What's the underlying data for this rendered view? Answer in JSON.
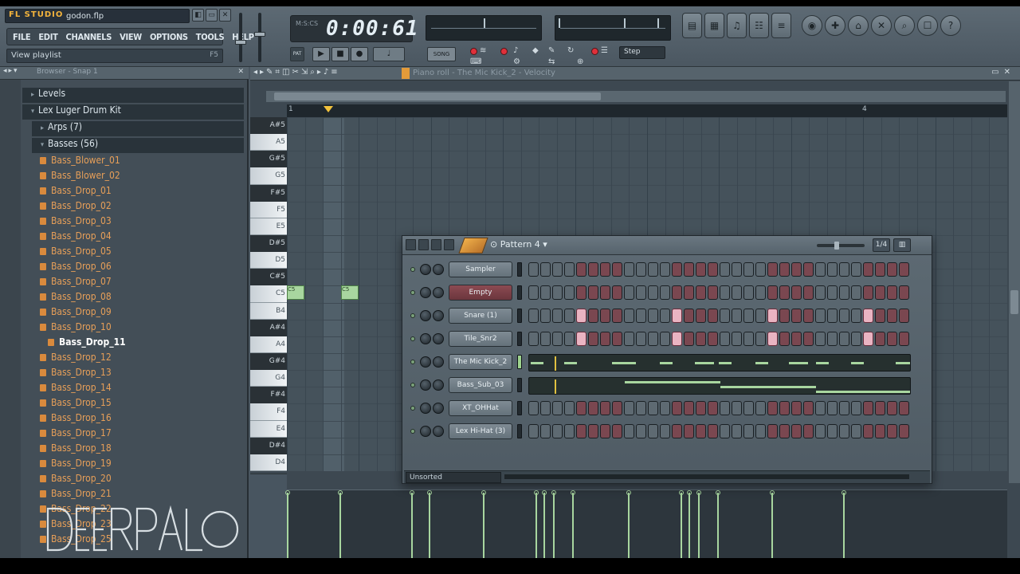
{
  "app": {
    "logo": "FL STUDIO",
    "file_name": "godon.flp",
    "window_buttons": [
      "◧",
      "▭",
      "✕"
    ]
  },
  "menu": [
    "FILE",
    "EDIT",
    "CHANNELS",
    "VIEW",
    "OPTIONS",
    "TOOLS",
    "HELP"
  ],
  "hint": {
    "text": "View playlist",
    "shortcut": "F5"
  },
  "time_display": {
    "value": "0:00:61",
    "mode": "M:S:CS"
  },
  "transport": {
    "pattern_mode": "PAT",
    "song_mode": "SONG",
    "step_label": "Step"
  },
  "browser": {
    "title": "Browser - Snap 1",
    "folders": [
      {
        "label": "Levels",
        "level": 1
      },
      {
        "label": "Lex Luger Drum Kit",
        "level": 1
      },
      {
        "label": "Arps (7)",
        "level": 2
      },
      {
        "label": "Basses (56)",
        "level": 2
      }
    ],
    "files": [
      "Bass_Blower_01",
      "Bass_Blower_02",
      "Bass_Drop_01",
      "Bass_Drop_02",
      "Bass_Drop_03",
      "Bass_Drop_04",
      "Bass_Drop_05",
      "Bass_Drop_06",
      "Bass_Drop_07",
      "Bass_Drop_08",
      "Bass_Drop_09",
      "Bass_Drop_10",
      "Bass_Drop_11",
      "Bass_Drop_12",
      "Bass_Drop_13",
      "Bass_Drop_14",
      "Bass_Drop_15",
      "Bass_Drop_16",
      "Bass_Drop_17",
      "Bass_Drop_18",
      "Bass_Drop_19",
      "Bass_Drop_20",
      "Bass_Drop_21",
      "Bass_Drop_22",
      "Bass_Drop_23",
      "Bass_Drop_25"
    ],
    "selected_file": "Bass_Drop_11",
    "watermark": "DEFERPALO"
  },
  "piano_roll": {
    "title": "Piano roll - The Mic Kick_2 - Velocity",
    "bar_numbers": [
      "1",
      "4"
    ],
    "keys": [
      {
        "label": "A#5",
        "type": "black"
      },
      {
        "label": "A5",
        "type": "white"
      },
      {
        "label": "G#5",
        "type": "black"
      },
      {
        "label": "G5",
        "type": "white"
      },
      {
        "label": "F#5",
        "type": "black"
      },
      {
        "label": "F5",
        "type": "white"
      },
      {
        "label": "E5",
        "type": "white"
      },
      {
        "label": "D#5",
        "type": "black"
      },
      {
        "label": "D5",
        "type": "white"
      },
      {
        "label": "C#5",
        "type": "black"
      },
      {
        "label": "C5",
        "type": "white"
      },
      {
        "label": "B4",
        "type": "white"
      },
      {
        "label": "A#4",
        "type": "black"
      },
      {
        "label": "A4",
        "type": "white"
      },
      {
        "label": "G#4",
        "type": "black"
      },
      {
        "label": "G4",
        "type": "white"
      },
      {
        "label": "F#4",
        "type": "black"
      },
      {
        "label": "F4",
        "type": "white"
      },
      {
        "label": "E4",
        "type": "white"
      },
      {
        "label": "D#4",
        "type": "black"
      },
      {
        "label": "D4",
        "type": "white"
      }
    ],
    "notes": [
      {
        "label": "C5",
        "step": 0
      },
      {
        "label": "C5",
        "step": 4
      }
    ]
  },
  "step_sequencer": {
    "pattern_label": "Pattern 4",
    "filter_label": "Unsorted",
    "channels": [
      {
        "name": "Sampler",
        "kind": "steps",
        "active_steps": [],
        "selected": false
      },
      {
        "name": "Empty",
        "kind": "steps",
        "active_steps": [],
        "selected": true
      },
      {
        "name": "Snare (1)",
        "kind": "steps",
        "active_steps": [
          4,
          12,
          20,
          28
        ],
        "selected": false
      },
      {
        "name": "Tile_Snr2",
        "kind": "steps",
        "active_steps": [
          4,
          12,
          20,
          28
        ],
        "selected": false
      },
      {
        "name": "The Mic Kick_2",
        "kind": "pianoroll",
        "selected": false
      },
      {
        "name": "Bass_Sub_03",
        "kind": "pianoroll",
        "selected": false
      },
      {
        "name": "XT_OHHat",
        "kind": "steps",
        "active_steps": [],
        "selected": false
      },
      {
        "name": "Lex Hi-Hat (3)",
        "kind": "steps",
        "active_steps": [],
        "selected": false
      }
    ]
  },
  "colors": {
    "accent_orange": "#e39b3a",
    "note_green": "#a8d69f",
    "step_on_pink": "#eab4c2",
    "file_orange": "#e79f58"
  }
}
